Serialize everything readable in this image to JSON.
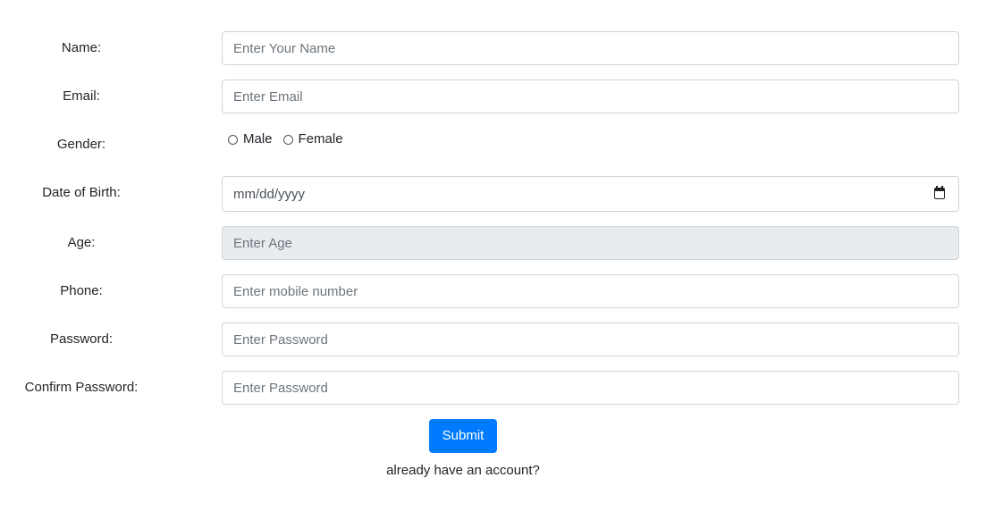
{
  "form": {
    "name": {
      "label": "Name:",
      "placeholder": "Enter Your Name",
      "value": ""
    },
    "email": {
      "label": "Email:",
      "placeholder": "Enter Email",
      "value": ""
    },
    "gender": {
      "label": "Gender:",
      "options": [
        {
          "label": "Male",
          "checked": false
        },
        {
          "label": "Female",
          "checked": false
        }
      ]
    },
    "dob": {
      "label": "Date of Birth:",
      "placeholder": "mm/dd/yyyy",
      "icon": "calendar-icon"
    },
    "age": {
      "label": "Age:",
      "placeholder": "Enter Age",
      "value": "",
      "readonly": true
    },
    "phone": {
      "label": "Phone:",
      "placeholder": "Enter mobile number",
      "value": ""
    },
    "password": {
      "label": "Password:",
      "placeholder": "Enter Password",
      "value": ""
    },
    "confirm_password": {
      "label": "Confirm Password:",
      "placeholder": "Enter Password",
      "value": ""
    },
    "submit_label": "Submit",
    "signin_link": "already have an account?"
  },
  "colors": {
    "primary": "#007bff",
    "readonly_bg": "#e9ecef",
    "border": "#ced4da",
    "placeholder": "#6c757d",
    "text": "#212529"
  }
}
